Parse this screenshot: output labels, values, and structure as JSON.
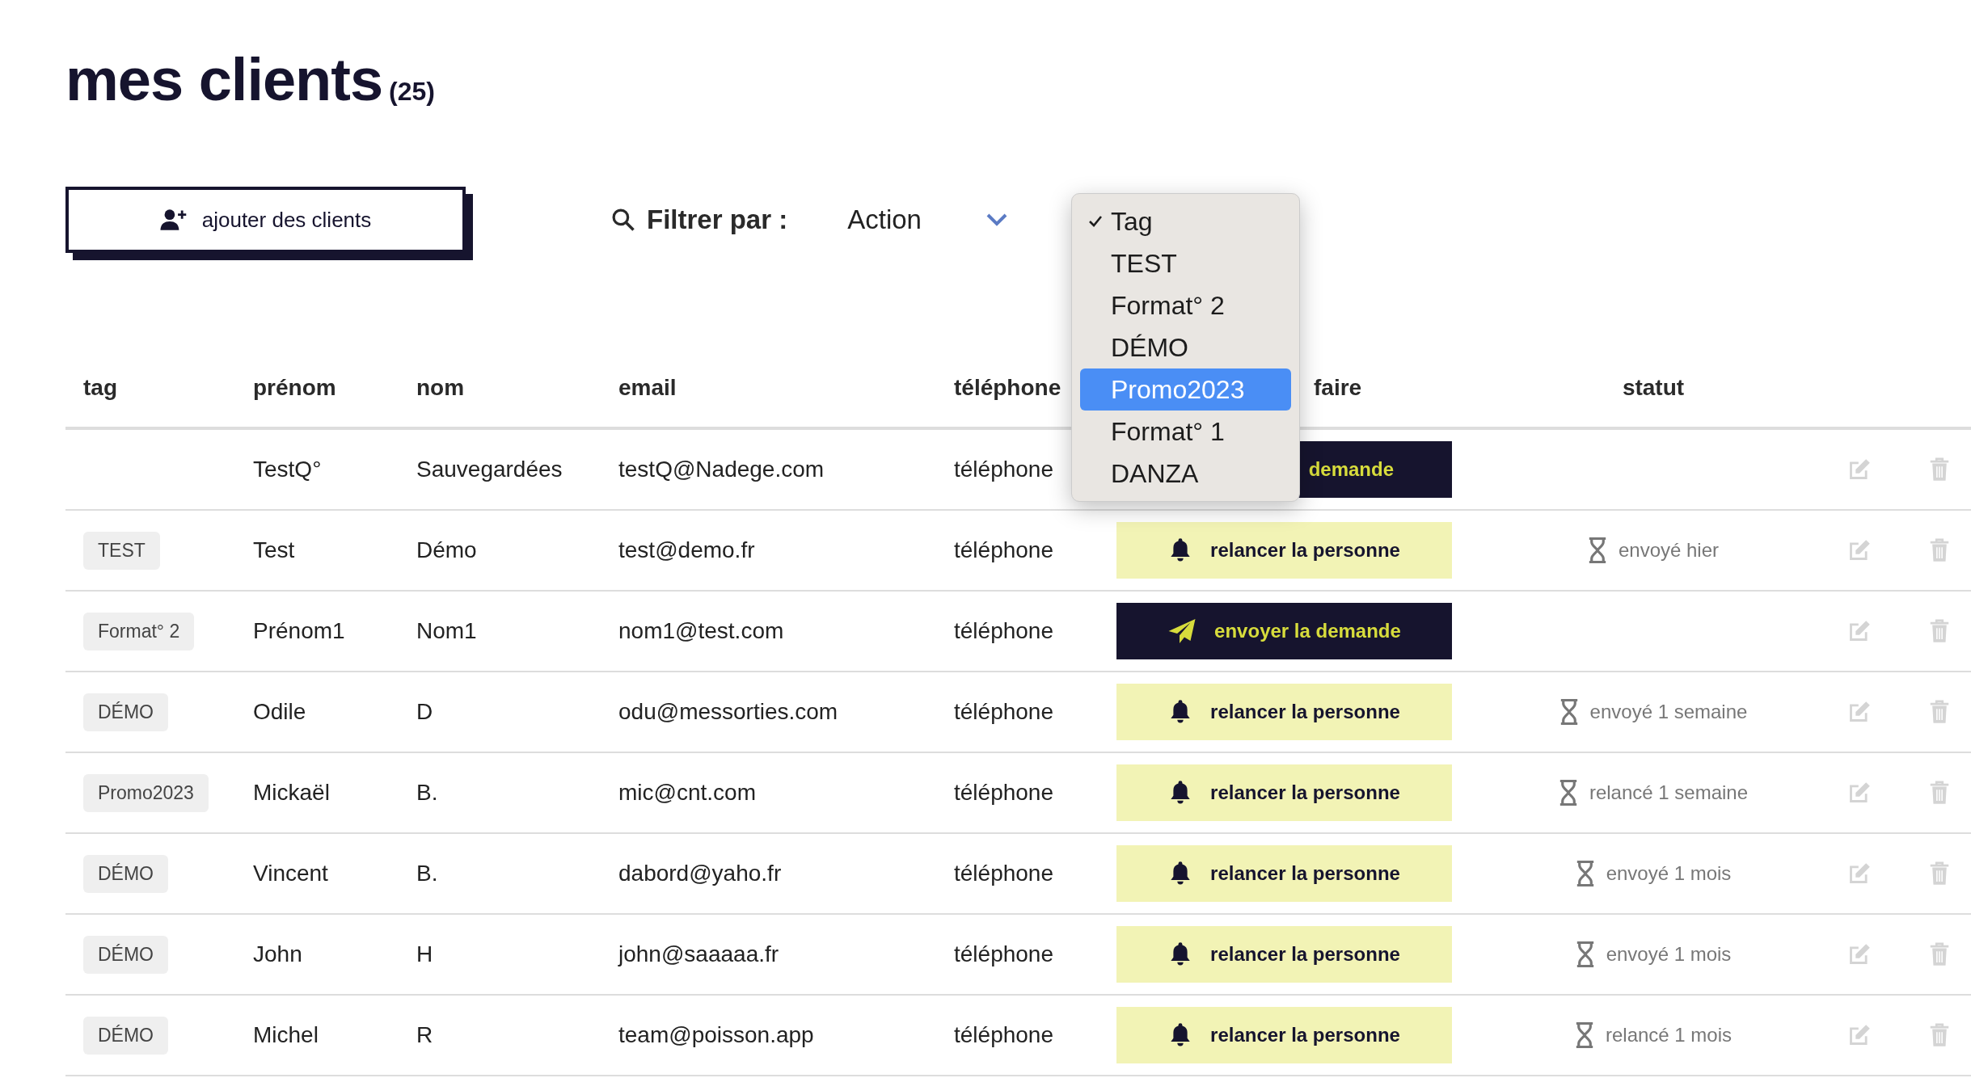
{
  "title": "mes clients",
  "count": "(25)",
  "add_button": "ajouter des clients",
  "filter": {
    "label": "Filtrer par :",
    "value": "Action"
  },
  "dropdown": [
    {
      "label": "Tag",
      "checked": true,
      "selected": false
    },
    {
      "label": "TEST",
      "checked": false,
      "selected": false
    },
    {
      "label": "Format° 2",
      "checked": false,
      "selected": false
    },
    {
      "label": "DÉMO",
      "checked": false,
      "selected": false
    },
    {
      "label": "Promo2023",
      "checked": false,
      "selected": true
    },
    {
      "label": "Format° 1",
      "checked": false,
      "selected": false
    },
    {
      "label": "DANZA",
      "checked": false,
      "selected": false
    }
  ],
  "columns": [
    "tag",
    "prénom",
    "nom",
    "email",
    "téléphone",
    "faire",
    "statut"
  ],
  "rows": [
    {
      "tag": "",
      "first": "TestQ°",
      "last": "Sauvegardées",
      "email": "testQ@Nadege.com",
      "phone": "téléphone",
      "action": {
        "kind": "send",
        "label": "demande",
        "covered": true
      },
      "status": ""
    },
    {
      "tag": "TEST",
      "first": "Test",
      "last": "Démo",
      "email": "test@demo.fr",
      "phone": "téléphone",
      "action": {
        "kind": "remind",
        "label": "relancer la personne",
        "covered": false
      },
      "status": "envoyé hier"
    },
    {
      "tag": "Format° 2",
      "first": "Prénom1",
      "last": "Nom1",
      "email": "nom1@test.com",
      "phone": "téléphone",
      "action": {
        "kind": "send",
        "label": "envoyer la demande",
        "covered": false
      },
      "status": ""
    },
    {
      "tag": "DÉMO",
      "first": "Odile",
      "last": "D",
      "email": "odu@messorties.com",
      "phone": "téléphone",
      "action": {
        "kind": "remind",
        "label": "relancer la personne",
        "covered": false
      },
      "status": "envoyé 1 semaine"
    },
    {
      "tag": "Promo2023",
      "first": "Mickaël",
      "last": "B.",
      "email": "mic@cnt.com",
      "phone": "téléphone",
      "action": {
        "kind": "remind",
        "label": "relancer la personne",
        "covered": false
      },
      "status": "relancé 1 semaine"
    },
    {
      "tag": "DÉMO",
      "first": "Vincent",
      "last": "B.",
      "email": "dabord@yaho.fr",
      "phone": "téléphone",
      "action": {
        "kind": "remind",
        "label": "relancer la personne",
        "covered": false
      },
      "status": "envoyé 1 mois"
    },
    {
      "tag": "DÉMO",
      "first": "John",
      "last": "H",
      "email": "john@saaaaa.fr",
      "phone": "téléphone",
      "action": {
        "kind": "remind",
        "label": "relancer la personne",
        "covered": false
      },
      "status": "envoyé 1 mois"
    },
    {
      "tag": "DÉMO",
      "first": "Michel",
      "last": "R",
      "email": "team@poisson.app",
      "phone": "téléphone",
      "action": {
        "kind": "remind",
        "label": "relancer la personne",
        "covered": false
      },
      "status": "relancé 1 mois"
    }
  ]
}
